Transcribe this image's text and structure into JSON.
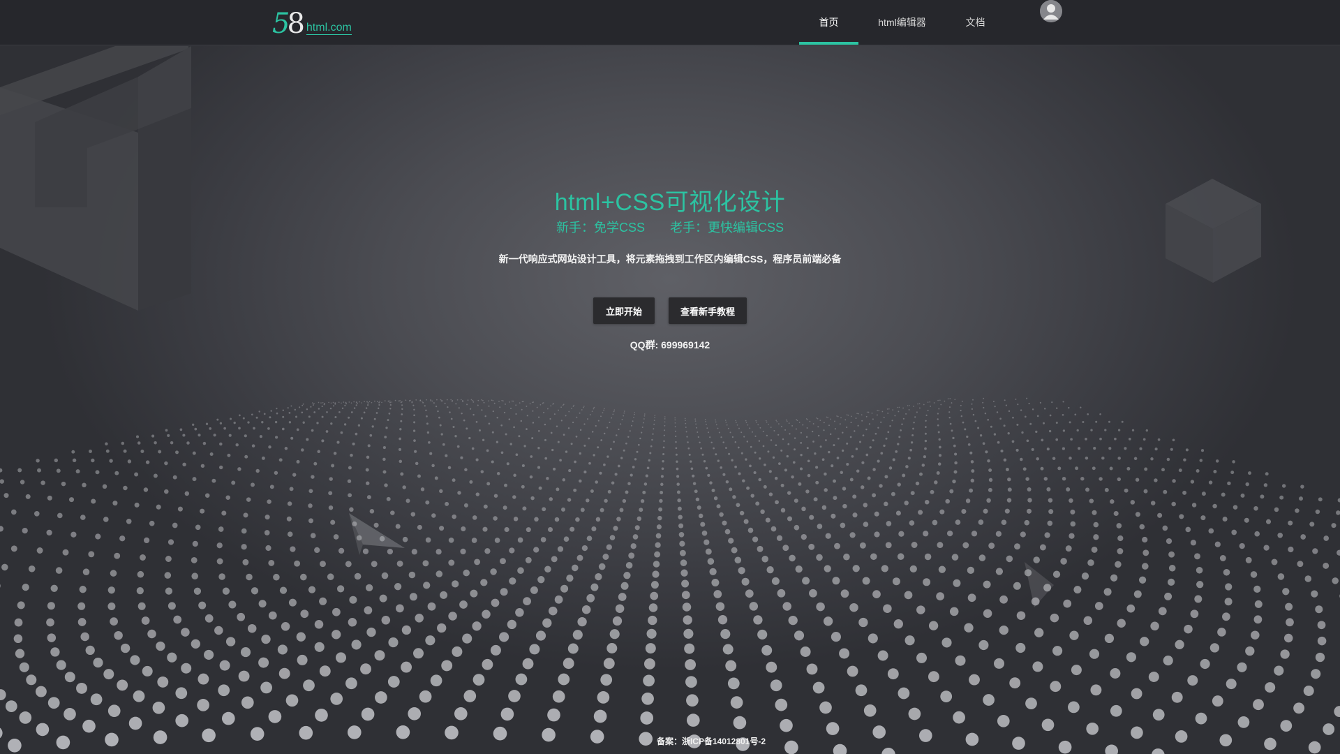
{
  "header": {
    "logo": {
      "number_part1": "5",
      "number_part2": "8",
      "domain": "html.com"
    },
    "nav": [
      {
        "label": "首页",
        "active": true
      },
      {
        "label": "html编辑器",
        "active": false
      },
      {
        "label": "文档",
        "active": false
      }
    ],
    "user_icon": "user-avatar-icon"
  },
  "hero": {
    "title": "html+CSS可视化设计",
    "subtitle_left": "新手：免学CSS",
    "subtitle_right": "老手：更快编辑CSS",
    "description": "新一代响应式网站设计工具，将元素拖拽到工作区内编辑CSS，程序员前端必备",
    "buttons": {
      "start": "立即开始",
      "tutorial": "查看新手教程"
    },
    "qq": "QQ群: 699969142"
  },
  "footer": {
    "icp": "备案：浙ICP备14012801号-2"
  },
  "colors": {
    "accent": "#2cc3a2",
    "topbar": "#26272c",
    "button": "#2b2b2e"
  }
}
